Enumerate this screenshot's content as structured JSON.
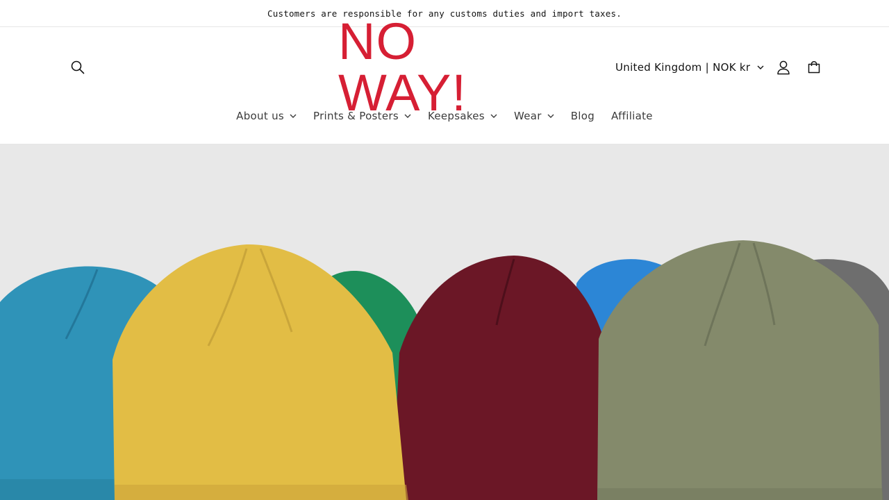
{
  "announcement": {
    "text": "Customers are responsible for any customs duties and import taxes."
  },
  "header": {
    "logo_text": "NO WAY!",
    "locale_label": "United Kingdom | NOK kr",
    "icons": {
      "search": "search-icon",
      "account": "user-icon",
      "cart": "bag-icon",
      "chevron": "chevron-down-icon"
    }
  },
  "nav": {
    "items": [
      {
        "label": "About us"
      },
      {
        "label": "Prints & Posters"
      },
      {
        "label": "Keepsakes"
      },
      {
        "label": "Wear"
      },
      {
        "label": "Blog"
      },
      {
        "label": "Affiliate"
      }
    ]
  },
  "colors": {
    "brand": "#d61f34",
    "hero_bg": "#e8e8e8",
    "beanies": [
      "#2f93b8",
      "#e2bd45",
      "#1d8f5a",
      "#6b1726",
      "#2c86d6",
      "#848a6b",
      "#6e6e6e"
    ]
  }
}
